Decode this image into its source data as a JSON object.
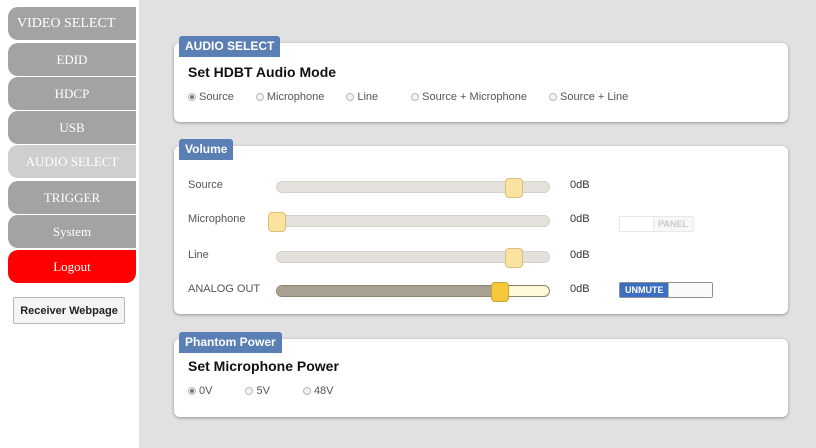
{
  "sidebar": {
    "items": [
      {
        "label": "VIDEO SELECT"
      },
      {
        "label": "EDID"
      },
      {
        "label": "HDCP"
      },
      {
        "label": "USB"
      },
      {
        "label": "AUDIO SELECT"
      },
      {
        "label": "TRIGGER"
      },
      {
        "label": "System"
      },
      {
        "label": "Logout"
      }
    ],
    "receiver_button": "Receiver Webpage"
  },
  "audio_select": {
    "tag": "AUDIO SELECT",
    "heading": "Set HDBT Audio Mode",
    "options": [
      "Source",
      "Microphone",
      "Line",
      "Source + Microphone",
      "Source + Line"
    ],
    "selected": "Source"
  },
  "volume": {
    "tag": "Volume",
    "rows": [
      {
        "label": "Source",
        "db": "0dB",
        "level": 0.87
      },
      {
        "label": "Microphone",
        "db": "0dB",
        "level": 0.0
      },
      {
        "label": "Line",
        "db": "0dB",
        "level": 0.87
      },
      {
        "label": "ANALOG OUT",
        "db": "0dB",
        "level": 0.82
      }
    ],
    "panel_toggle": "PANEL",
    "mute_toggle": "UNMUTE"
  },
  "phantom_power": {
    "tag": "Phantom Power",
    "heading": "Set Microphone Power",
    "options": [
      "0V",
      "5V",
      "48V"
    ],
    "selected": "0V"
  },
  "colors": {
    "tag_blue": "#5a7fb5",
    "logout_red": "#ff0000",
    "nav_gray": "#a3a3a3",
    "nav_active": "#cfcfcf",
    "unmute_blue": "#3c6fc1"
  }
}
